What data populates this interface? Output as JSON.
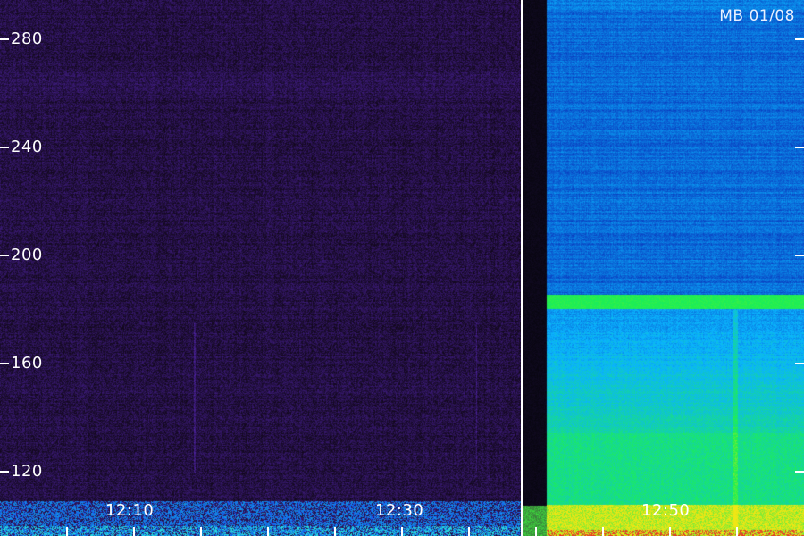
{
  "stamp": "MB 01/08",
  "y_axis": {
    "labels": [
      "280",
      "240",
      "200",
      "160",
      "120"
    ]
  },
  "x_axis": {
    "labels": [
      "12:10",
      "12:30",
      "12:50"
    ]
  },
  "colors": {
    "background_dark": "#120a1c",
    "noise_purple": "#3a1f66",
    "active_blue": "#1e64ff",
    "band_green": "#19e650",
    "base_yellow": "#e6e619",
    "divider": "#ffffff"
  }
}
